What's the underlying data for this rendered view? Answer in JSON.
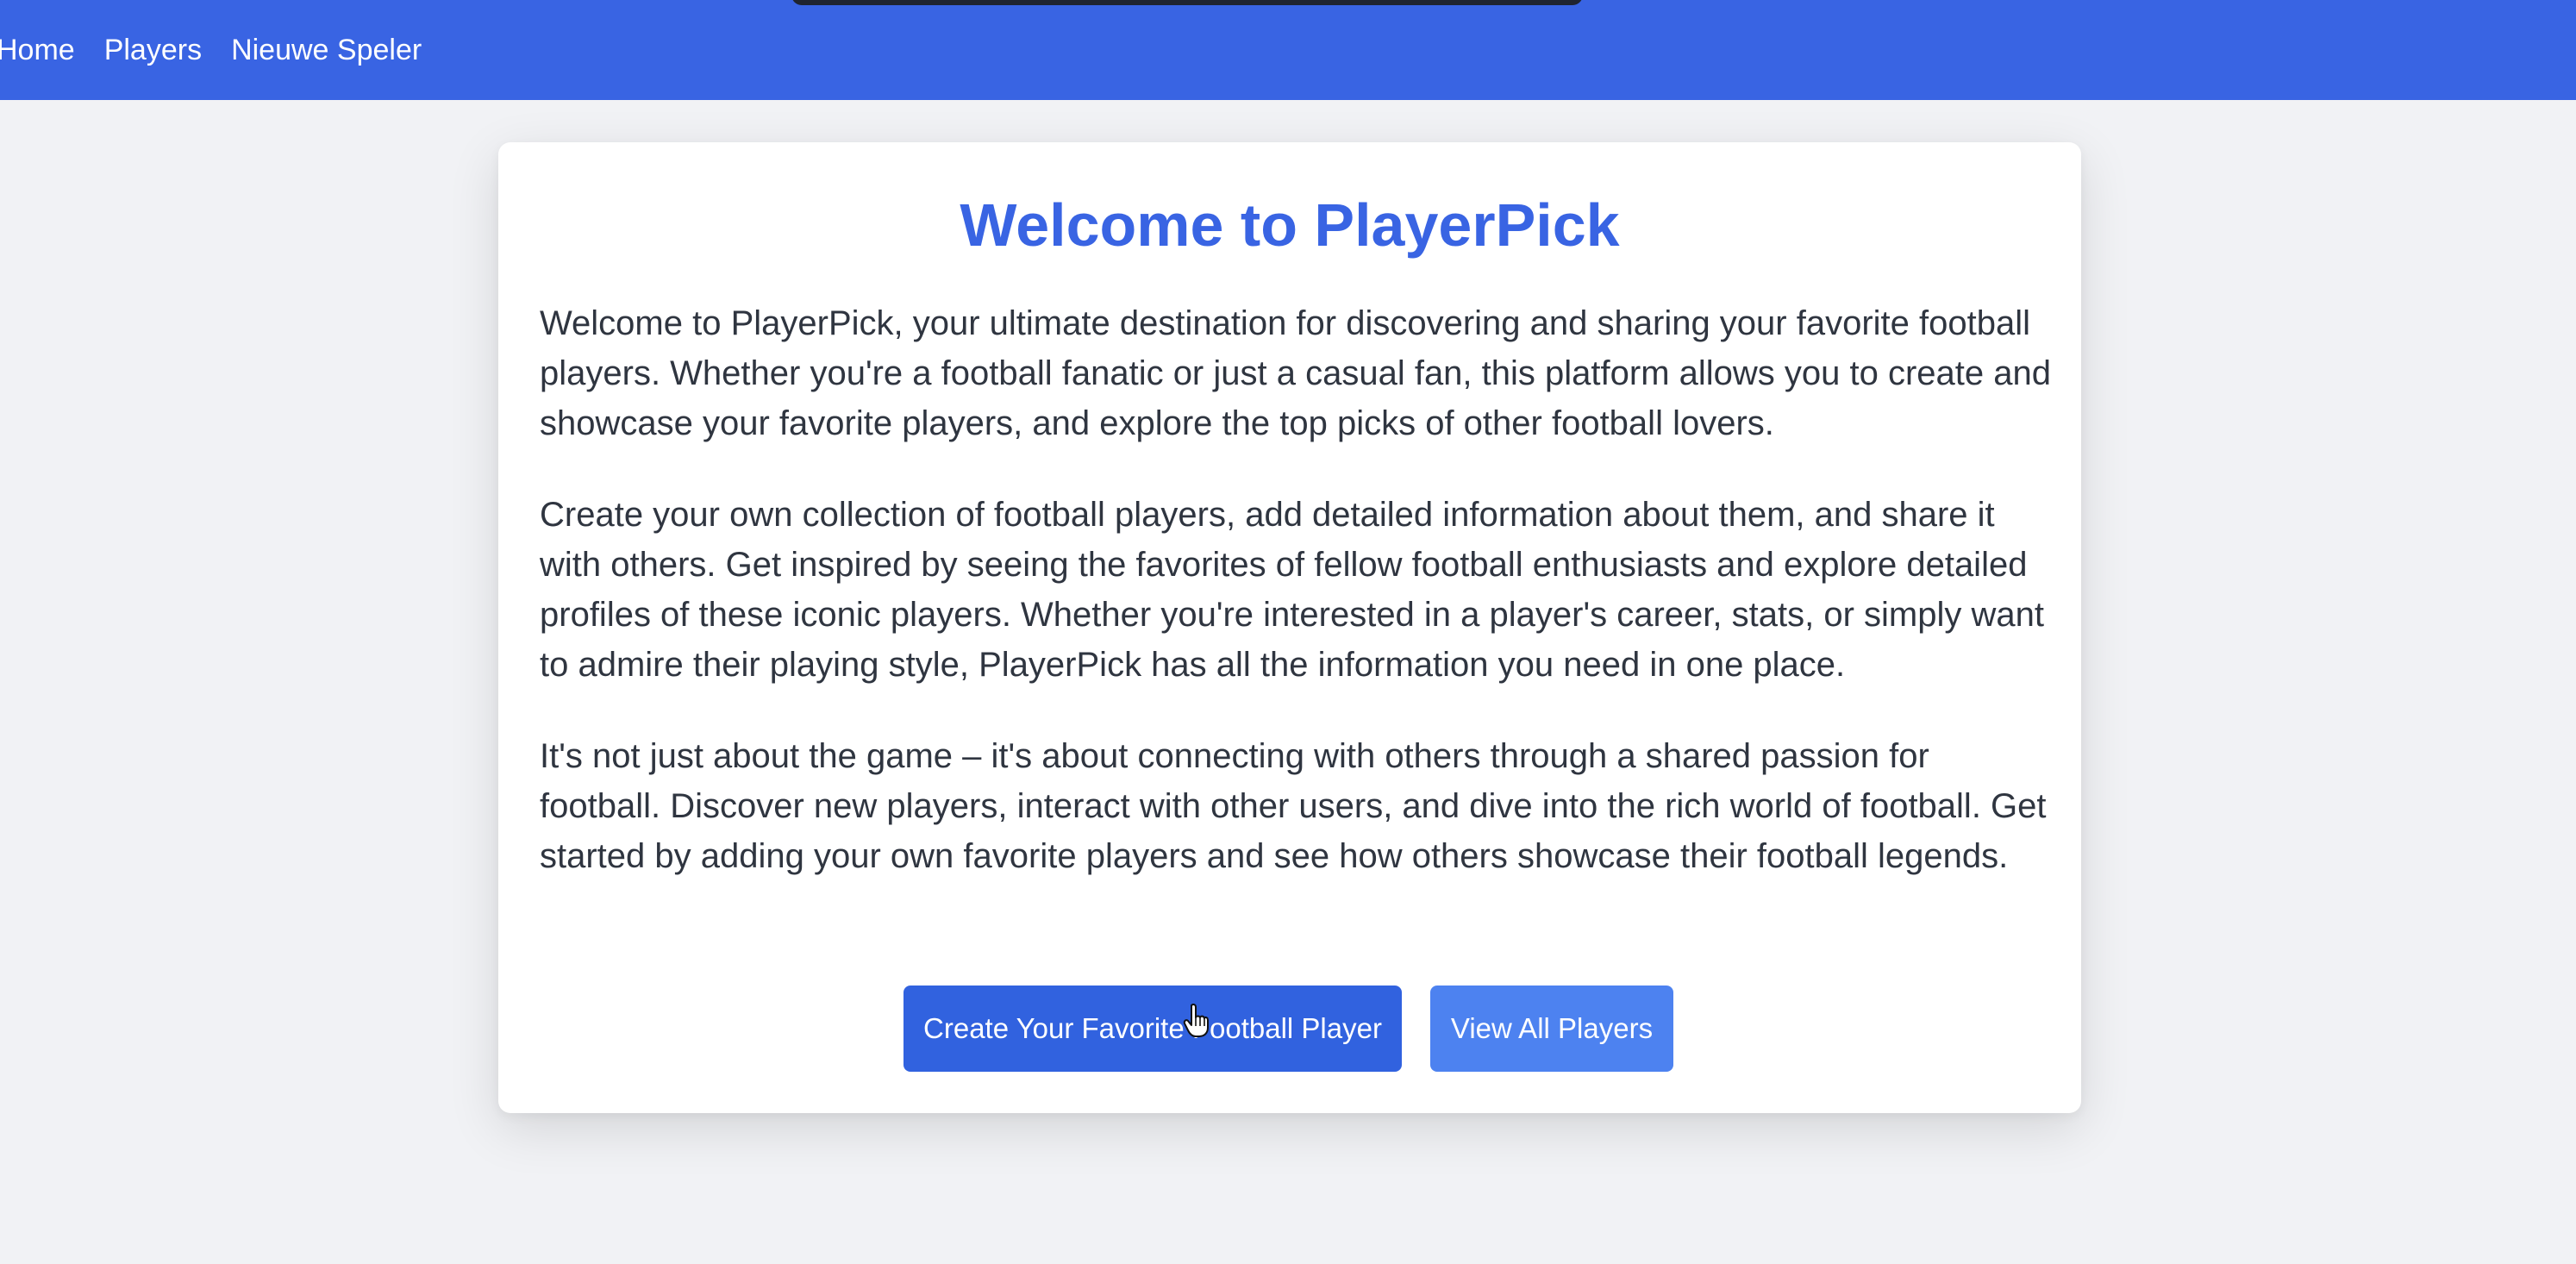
{
  "nav": {
    "links": [
      "Home",
      "Players",
      "Nieuwe Speler"
    ]
  },
  "main": {
    "title": "Welcome to PlayerPick",
    "paragraphs": [
      "Welcome to PlayerPick, your ultimate destination for discovering and sharing your favorite football players. Whether you're a football fanatic or just a casual fan, this platform allows you to create and showcase your favorite players, and explore the top picks of other football lovers.",
      "Create your own collection of football players, add detailed information about them, and share it with others. Get inspired by seeing the favorites of fellow football enthusiasts and explore detailed profiles of these iconic players. Whether you're interested in a player's career, stats, or simply want to admire their playing style, PlayerPick has all the information you need in one place.",
      "It's not just about the game – it's about connecting with others through a shared passion for football. Discover new players, interact with other users, and dive into the rich world of football. Get started by adding your own favorite players and see how others showcase their football legends."
    ],
    "buttons": {
      "create": "Create Your Favorite Football Player",
      "view_all": "View All Players"
    }
  },
  "colors": {
    "accent": "#3964e3",
    "primary_button": "#3162df",
    "secondary_button": "#4d82f0",
    "background": "#f1f2f5",
    "text": "#2f3540"
  },
  "icons": {
    "cursor": "hand-pointer-icon"
  }
}
